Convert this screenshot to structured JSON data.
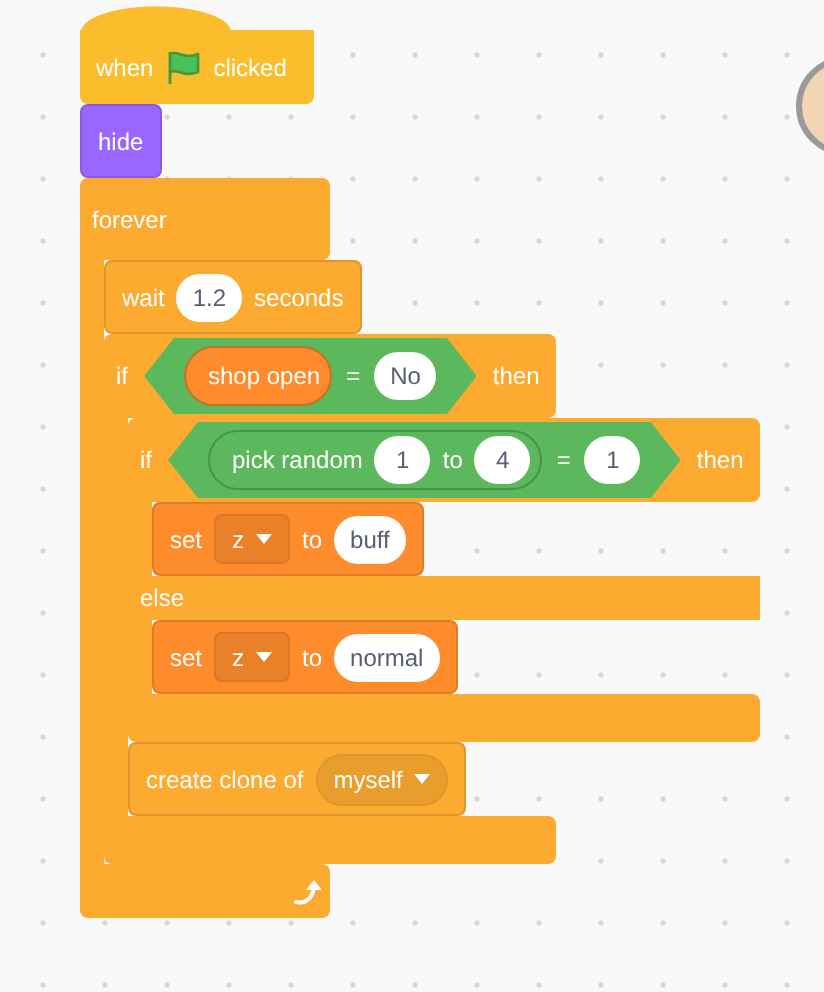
{
  "script": [
    {
      "kind": "hat",
      "color": "#fbbd2c",
      "parts": [
        {
          "kind": "label",
          "text": "when"
        },
        {
          "kind": "flag"
        },
        {
          "kind": "label",
          "text": "clicked"
        }
      ]
    },
    {
      "kind": "command",
      "color": "#9966ff",
      "parts": [
        {
          "kind": "label",
          "text": "hide"
        }
      ]
    },
    {
      "kind": "c",
      "color": "#fdab30",
      "loop": true,
      "parts": [
        {
          "kind": "label",
          "text": "forever"
        }
      ],
      "body": [
        {
          "kind": "command",
          "color": "#fdab30",
          "parts": [
            {
              "kind": "label",
              "text": "wait"
            },
            {
              "kind": "input",
              "text": "1.2"
            },
            {
              "kind": "label",
              "text": "seconds"
            }
          ]
        },
        {
          "kind": "c",
          "color": "#fdab30",
          "loop": false,
          "parts": [
            {
              "kind": "label",
              "text": "if"
            },
            {
              "kind": "boolean",
              "color": "#5cb85c",
              "parts": [
                {
                  "kind": "reporter",
                  "color": "#fe8c2d",
                  "parts": [
                    {
                      "kind": "label",
                      "text": "shop open"
                    }
                  ]
                },
                {
                  "kind": "label",
                  "text": "="
                },
                {
                  "kind": "input",
                  "text": "No"
                }
              ]
            },
            {
              "kind": "label",
              "text": "then"
            }
          ],
          "body": [
            {
              "kind": "c",
              "color": "#fdab30",
              "loop": false,
              "parts": [
                {
                  "kind": "label",
                  "text": "if"
                },
                {
                  "kind": "boolean",
                  "color": "#5cb85c",
                  "parts": [
                    {
                      "kind": "reporter",
                      "color": "#5cb85c",
                      "parts": [
                        {
                          "kind": "label",
                          "text": "pick random"
                        },
                        {
                          "kind": "input",
                          "text": "1"
                        },
                        {
                          "kind": "label",
                          "text": "to"
                        },
                        {
                          "kind": "input",
                          "text": "4"
                        }
                      ]
                    },
                    {
                      "kind": "label",
                      "text": "="
                    },
                    {
                      "kind": "input",
                      "text": "1"
                    }
                  ]
                },
                {
                  "kind": "label",
                  "text": "then"
                }
              ],
              "body": [
                {
                  "kind": "command",
                  "color": "#fe8c2d",
                  "parts": [
                    {
                      "kind": "label",
                      "text": "set"
                    },
                    {
                      "kind": "dropdown",
                      "text": "z"
                    },
                    {
                      "kind": "label",
                      "text": "to"
                    },
                    {
                      "kind": "input",
                      "text": "buff"
                    }
                  ]
                }
              ],
              "else": {
                "label": "else",
                "body": [
                  {
                    "kind": "command",
                    "color": "#fe8c2d",
                    "parts": [
                      {
                        "kind": "label",
                        "text": "set"
                      },
                      {
                        "kind": "dropdown",
                        "text": "z"
                      },
                      {
                        "kind": "label",
                        "text": "to"
                      },
                      {
                        "kind": "input",
                        "text": "normal"
                      }
                    ]
                  }
                ]
              }
            },
            {
              "kind": "command",
              "color": "#fdab30",
              "parts": [
                {
                  "kind": "label",
                  "text": "create clone of"
                },
                {
                  "kind": "menu",
                  "text": "myself"
                }
              ]
            }
          ]
        }
      ]
    }
  ]
}
